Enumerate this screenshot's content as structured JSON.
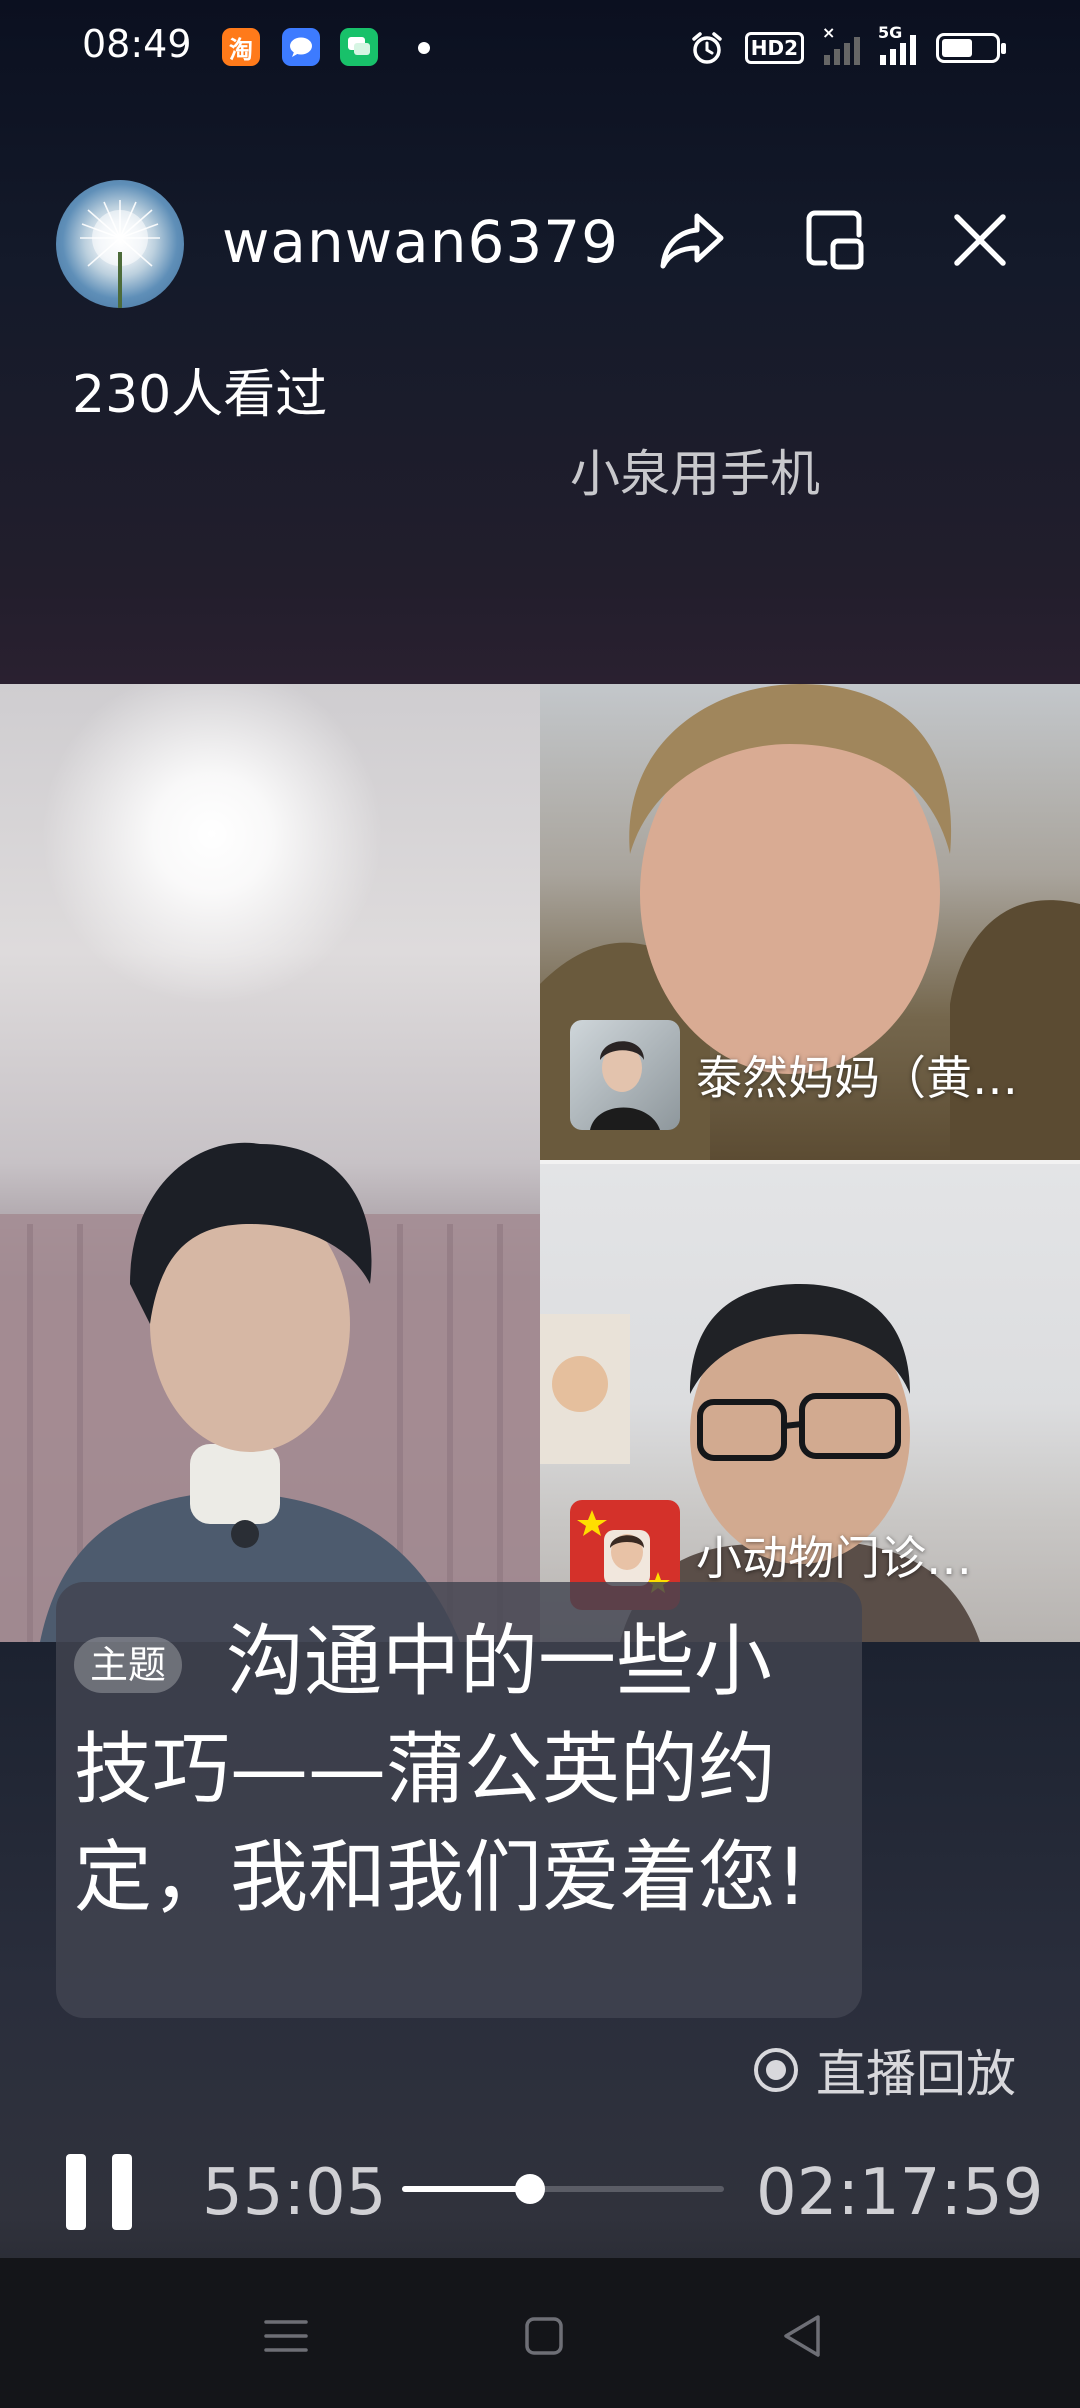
{
  "status_bar": {
    "time": "08:49",
    "apps": [
      {
        "name": "taobao-icon",
        "glyph": "淘",
        "color": "#ff7a1a"
      },
      {
        "name": "message-bubble-icon",
        "glyph": "",
        "color": "#3d7bff"
      },
      {
        "name": "chat-app-icon",
        "glyph": "",
        "color": "#18c16a"
      }
    ],
    "hd_label": "HD2",
    "net_label": "5G",
    "battery_level": 0.62
  },
  "header": {
    "username": "wanwan6379",
    "viewers": "230人看过",
    "room_label": "小泉用手机"
  },
  "guests": [
    {
      "name": "泰然妈妈（黄…"
    },
    {
      "name": "小动物门诊…"
    }
  ],
  "topic": {
    "tag": "主题",
    "text": "沟通中的一些小技巧——蒲公英的约定，我和我们爱着您!"
  },
  "replay": {
    "label": "直播回放"
  },
  "player": {
    "current_time": "55:05",
    "total_time": "02:17:59",
    "progress": 0.399
  },
  "colors": {
    "accent": "#ffffff",
    "card": "#424450"
  }
}
